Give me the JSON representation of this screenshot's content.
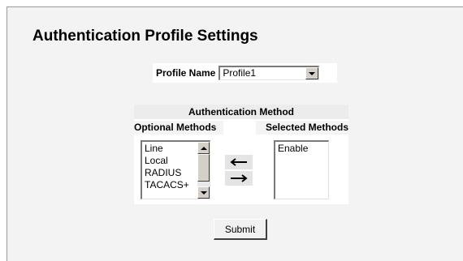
{
  "page": {
    "title": "Authentication Profile Settings"
  },
  "profile": {
    "label": "Profile Name",
    "selected": "Profile1"
  },
  "auth_method": {
    "header": "Authentication Method",
    "optional_label": "Optional Methods",
    "selected_label": "Selected Methods",
    "optional_items": [
      "Line",
      "Local",
      "RADIUS",
      "TACACS+"
    ],
    "selected_items": [
      "Enable"
    ],
    "move_left_icon": "arrow-left-icon",
    "move_right_icon": "arrow-right-icon"
  },
  "actions": {
    "submit_label": "Submit"
  },
  "colors": {
    "panel_bg": "#f3f3f3",
    "table_header_bg": "#ececec"
  }
}
